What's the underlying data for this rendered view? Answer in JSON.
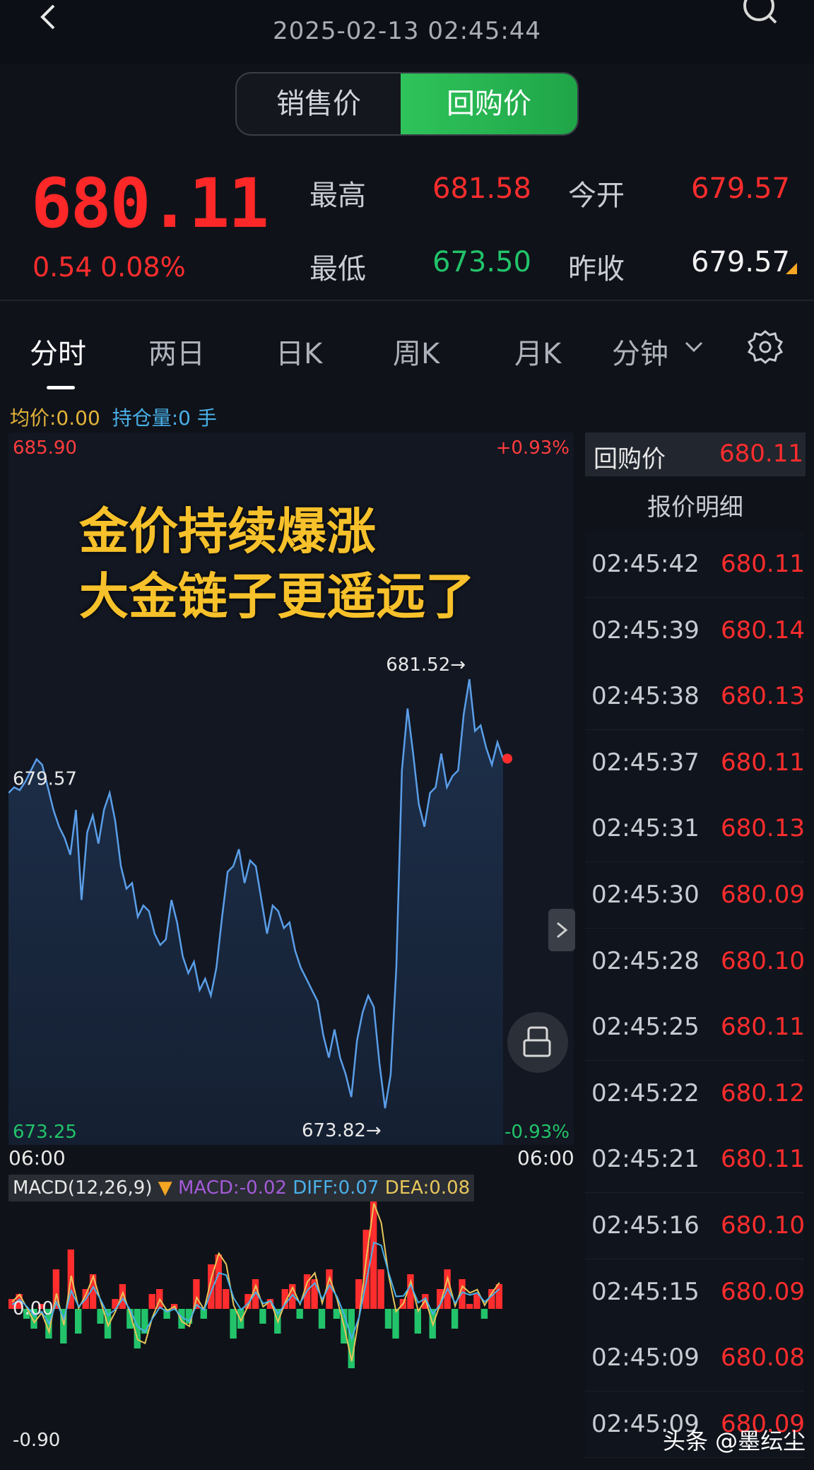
{
  "header": {
    "timestamp": "2025-02-13 02:45:44",
    "toggle_sale": "销售价",
    "toggle_buyback": "回购价"
  },
  "price": {
    "current": "680.11",
    "change": "0.54",
    "change_pct": "0.08%",
    "high_label": "最高",
    "high": "681.58",
    "open_label": "今开",
    "open": "679.57",
    "low_label": "最低",
    "low": "673.50",
    "prev_close_label": "昨收",
    "prev_close": "679.57"
  },
  "tabs": [
    "分时",
    "两日",
    "日K",
    "周K",
    "月K",
    "分钟"
  ],
  "info": {
    "avg_label": "均价:0.00",
    "position_label": "持仓量:0 手"
  },
  "caption": {
    "line1": "金价持续爆涨",
    "line2": "大金链子更遥远了"
  },
  "chart_data": {
    "type": "line",
    "y_top_label": "685.90",
    "y_bottom_label": "673.25",
    "pct_top_label": "+0.93%",
    "pct_bottom_label": "-0.93%",
    "ref_label": "679.57",
    "x_start_label": "06:00",
    "x_end_label": "06:00",
    "ylim": [
      673.25,
      685.9
    ],
    "high_marker": "681.52→",
    "low_marker": "673.82→",
    "values": [
      679.5,
      679.6,
      679.55,
      679.7,
      679.9,
      680.1,
      680.0,
      679.6,
      679.2,
      678.9,
      678.7,
      678.4,
      679.2,
      677.6,
      678.8,
      679.1,
      678.6,
      679.2,
      679.5,
      679.0,
      678.2,
      677.8,
      677.9,
      677.3,
      677.5,
      677.4,
      677.0,
      676.8,
      676.9,
      677.6,
      677.2,
      676.6,
      676.3,
      676.5,
      676.0,
      676.2,
      675.9,
      676.4,
      677.3,
      678.1,
      678.2,
      678.5,
      677.9,
      678.3,
      678.2,
      677.6,
      677.0,
      677.5,
      677.4,
      677.1,
      677.2,
      676.7,
      676.4,
      676.2,
      676.0,
      675.8,
      675.2,
      674.8,
      675.3,
      674.8,
      674.5,
      674.1,
      675.1,
      675.6,
      675.9,
      675.7,
      674.7,
      673.9,
      674.5,
      676.4,
      679.9,
      681.0,
      680.2,
      679.3,
      678.9,
      679.5,
      679.6,
      680.2,
      679.6,
      679.8,
      679.9,
      680.9,
      681.52,
      680.6,
      680.7,
      680.3,
      680.0,
      680.4,
      680.11
    ],
    "macd_title": "MACD(12,26,9)",
    "macd_label": "MACD:-0.02",
    "diff_label": "DIFF:0.07",
    "dea_label": "DEA:0.08",
    "macd_zero_label": "0.00",
    "macd_bottom_label": "-0.90",
    "macd_hist": [
      0.1,
      0.15,
      -0.1,
      -0.2,
      0.05,
      -0.3,
      0.4,
      -0.35,
      0.6,
      -0.25,
      0.2,
      0.35,
      -0.15,
      -0.3,
      0.1,
      0.25,
      -0.2,
      -0.4,
      -0.25,
      0.15,
      0.2,
      -0.1,
      0.05,
      -0.2,
      -0.15,
      0.3,
      -0.1,
      0.45,
      0.55,
      0.2,
      -0.3,
      -0.2,
      0.15,
      0.3,
      -0.15,
      0.1,
      -0.25,
      0.2,
      0.25,
      -0.1,
      0.35,
      0.3,
      -0.2,
      0.4,
      -0.1,
      -0.35,
      -0.6,
      0.3,
      0.8,
      1.1,
      0.4,
      -0.2,
      -0.3,
      0.1,
      0.35,
      -0.25,
      0.15,
      -0.3,
      0.2,
      0.4,
      -0.2,
      0.3,
      0.05,
      0.15,
      -0.1,
      0.2,
      0.25
    ]
  },
  "quote_panel": {
    "title": "回购价",
    "title_price": "680.11",
    "detail_label": "报价明细",
    "ticks": [
      {
        "time": "02:45:42",
        "price": "680.11"
      },
      {
        "time": "02:45:39",
        "price": "680.14"
      },
      {
        "time": "02:45:38",
        "price": "680.13"
      },
      {
        "time": "02:45:37",
        "price": "680.11"
      },
      {
        "time": "02:45:31",
        "price": "680.13"
      },
      {
        "time": "02:45:30",
        "price": "680.09"
      },
      {
        "time": "02:45:28",
        "price": "680.10"
      },
      {
        "time": "02:45:25",
        "price": "680.11"
      },
      {
        "time": "02:45:22",
        "price": "680.12"
      },
      {
        "time": "02:45:21",
        "price": "680.11"
      },
      {
        "time": "02:45:16",
        "price": "680.10"
      },
      {
        "time": "02:45:15",
        "price": "680.09"
      },
      {
        "time": "02:45:09",
        "price": "680.08"
      },
      {
        "time": "02:45:09",
        "price": "680.09"
      }
    ]
  },
  "watermark": "头条 @墨纭尘",
  "colors": {
    "up": "#ff2d2d",
    "down": "#22c36a",
    "line": "#4a90e2",
    "caption": "#f7c12b"
  }
}
